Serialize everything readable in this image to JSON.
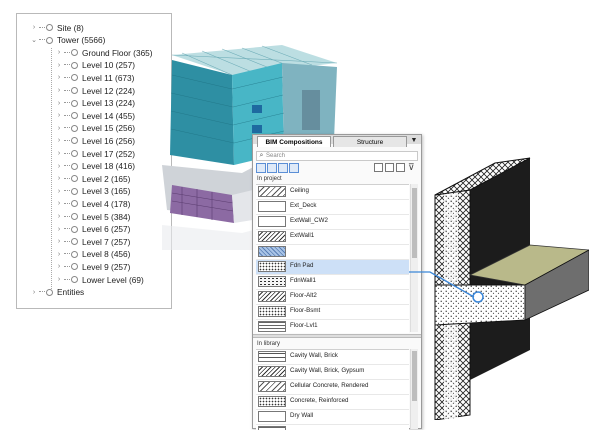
{
  "tree": {
    "items": [
      {
        "label": "Site (8)",
        "expanded": false
      },
      {
        "label": "Tower (5566)",
        "expanded": true
      },
      {
        "label": "Ground Floor (365)"
      },
      {
        "label": "Level 10 (257)"
      },
      {
        "label": "Level 11 (673)"
      },
      {
        "label": "Level 12 (224)"
      },
      {
        "label": "Level 13 (224)"
      },
      {
        "label": "Level 14 (455)"
      },
      {
        "label": "Level 15 (256)"
      },
      {
        "label": "Level 16 (256)"
      },
      {
        "label": "Level 17 (252)"
      },
      {
        "label": "Level 18 (416)"
      },
      {
        "label": "Level 2 (165)"
      },
      {
        "label": "Level 3 (165)"
      },
      {
        "label": "Level 4 (178)"
      },
      {
        "label": "Level 5 (384)"
      },
      {
        "label": "Level 6 (257)"
      },
      {
        "label": "Level 7 (257)"
      },
      {
        "label": "Level 8 (456)"
      },
      {
        "label": "Level 9 (257)"
      },
      {
        "label": "Lower Level (69)"
      },
      {
        "label": "Entities",
        "expanded": false
      }
    ]
  },
  "panel": {
    "tabs": [
      "BIM Compositions",
      "Structure"
    ],
    "menu_glyph": "▼",
    "search_placeholder": "Search",
    "in_project_label": "In project",
    "in_library_label": "In library",
    "project_items": [
      {
        "label": "Ceiling",
        "swatch": "diag2"
      },
      {
        "label": "Ext_Deck",
        "swatch": "plain"
      },
      {
        "label": "ExtWall_CW2",
        "swatch": "plain"
      },
      {
        "label": "ExtWall1",
        "swatch": "diag"
      },
      {
        "label": "",
        "swatch": "blue"
      },
      {
        "label": "Fdn Pad",
        "swatch": "dots",
        "selected": true
      },
      {
        "label": "FdnWall1",
        "swatch": "dots2"
      },
      {
        "label": "Floor-Alt2",
        "swatch": "diag"
      },
      {
        "label": "Floor-Bsmt",
        "swatch": "dots"
      },
      {
        "label": "Floor-Lvl1",
        "swatch": "grid"
      }
    ],
    "library_items": [
      {
        "label": "Cavity Wall, Brick",
        "swatch": "brick"
      },
      {
        "label": "Cavity Wall, Brick, Gypsum",
        "swatch": "diag"
      },
      {
        "label": "Cellular Concrete, Rendered",
        "swatch": "diag2"
      },
      {
        "label": "Concrete, Reinforced",
        "swatch": "dots"
      },
      {
        "label": "Dry Wall",
        "swatch": "plain"
      },
      {
        "label": "",
        "swatch": "grid"
      }
    ]
  },
  "colors": {
    "selection": "#cde0f7",
    "callout": "#3a86d8",
    "building_glass": "#3aa6b9",
    "building_purple": "#8a6a9c",
    "wall_top": "#b9b98a"
  }
}
